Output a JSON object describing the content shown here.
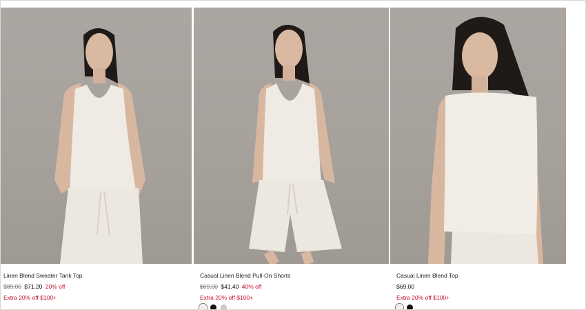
{
  "products": [
    {
      "name": "Linen Blend Sweater Tank Top",
      "original_price": "$89.00",
      "sale_price": "$71.20",
      "discount": "20% off",
      "promo": "Extra 20% off $100+",
      "swatches": []
    },
    {
      "name": "Casual Linen Blend Pull-On Shorts",
      "original_price": "$69.00",
      "sale_price": "$41.40",
      "discount": "40% off",
      "promo": "Extra 20% off $100+",
      "swatches": [
        "#f2efe8",
        "#111111",
        "#c9c9c9"
      ]
    },
    {
      "name": "Casual Linen Blend Top",
      "original_price": "",
      "sale_price": "$69.00",
      "discount": "",
      "promo": "Extra 20% off $100+",
      "swatches": [
        "#f2efe8",
        "#111111"
      ]
    }
  ],
  "colors": {
    "discount_red": "#c8102e",
    "backdrop": "#a9a39e",
    "garment_cream": "#f1ede6"
  }
}
